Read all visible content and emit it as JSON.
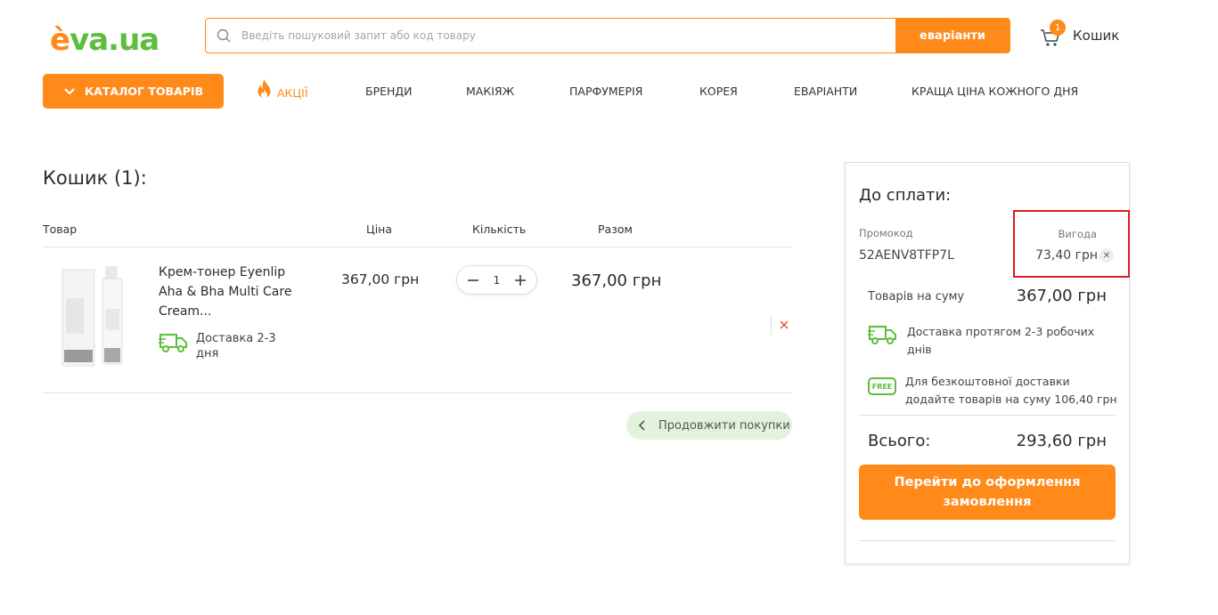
{
  "header": {
    "logo_e": "è",
    "logo_rest": "va.ua",
    "search_placeholder": "Введіть пошуковий запит або код товару",
    "search_button": "еваріанти",
    "cart_label": "Кошик",
    "cart_count": "1"
  },
  "colors": {
    "accent": "#ff8a1a",
    "green": "#5bbf3b",
    "highlight": "#e11b1b"
  },
  "nav": {
    "catalog": "КАТАЛОГ ТОВАРІВ",
    "items": [
      "АКЦІЇ",
      "БРЕНДИ",
      "МАКІЯЖ",
      "ПАРФУМЕРІЯ",
      "КОРЕЯ",
      "EВАРІАНТИ",
      "КРАЩА ЦІНА КОЖНОГО ДНЯ"
    ]
  },
  "cart": {
    "title": "Кошик (1):",
    "columns": {
      "product": "Товар",
      "price": "Ціна",
      "qty": "Кількість",
      "total": "Разом"
    },
    "item": {
      "name": "Крем-тонер Eyenlip Aha & Bha Multi Care Cream...",
      "delivery": "Доставка 2-3 дня",
      "price": "367,00 грн",
      "qty": "1",
      "total": "367,00 грн"
    },
    "continue": "Продовжити покупки"
  },
  "summary": {
    "title": "До сплати:",
    "promo_label": "Промокод",
    "promo_code": "52AENV8TFP7L",
    "benefit_label": "Вигода",
    "benefit_value": "73,40 грн",
    "goods_label": "Товарів на суму",
    "goods_value": "367,00 грн",
    "delivery_text": "Доставка протягом 2-3 робочих днів",
    "free_badge": "FREE",
    "free_text": "Для безкоштовної доставки додайте товарів на суму 106,40 грн",
    "total_label": "Всього:",
    "total_value": "293,60 грн",
    "checkout": "Перейти до оформлення замовлення"
  }
}
